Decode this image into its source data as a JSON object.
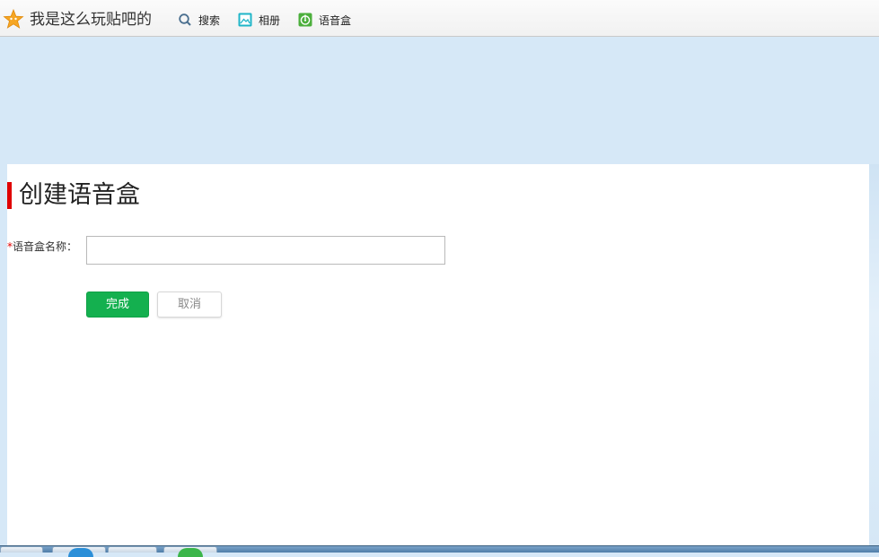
{
  "header": {
    "site_title": "我是这么玩贴吧的",
    "nav": [
      {
        "label": "搜索",
        "icon": "search-icon"
      },
      {
        "label": "相册",
        "icon": "album-icon"
      },
      {
        "label": "语音盒",
        "icon": "voice-box-icon"
      }
    ]
  },
  "form": {
    "title": "创建语音盒",
    "required_mark": "*",
    "name_label": "语音盒名称：",
    "name_value": "",
    "done_label": "完成",
    "cancel_label": "取消"
  },
  "colors": {
    "accent_red": "#e00000",
    "done_green": "#14b04f",
    "page_bg": "#d6e8f7"
  }
}
